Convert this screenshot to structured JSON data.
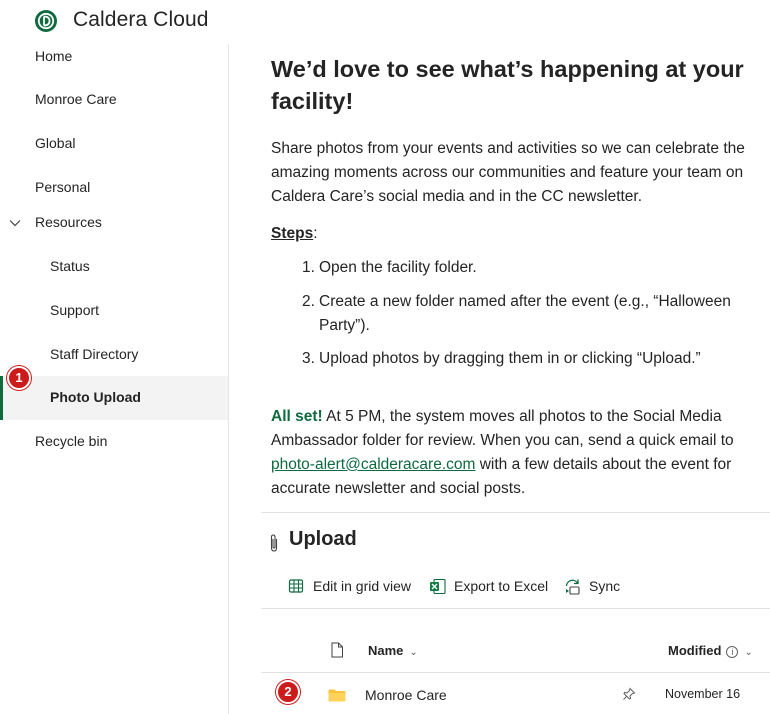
{
  "app": {
    "title": "Caldera Cloud"
  },
  "sidebar": {
    "items": [
      {
        "label": "Home"
      },
      {
        "label": "Monroe Care"
      },
      {
        "label": "Global"
      },
      {
        "label": "Personal"
      },
      {
        "label": "Resources"
      },
      {
        "label": "Status"
      },
      {
        "label": "Support"
      },
      {
        "label": "Staff Directory"
      },
      {
        "label": "Photo Upload"
      },
      {
        "label": "Recycle bin"
      }
    ],
    "selected": "Photo Upload"
  },
  "badges": {
    "one": "1",
    "two": "2"
  },
  "main": {
    "heading": "We’d love to see what’s happening at your facility!",
    "intro": "Share photos from your events and activities so we can celebrate the amazing moments across our communities and feature your team on Caldera Care’s social media and in the CC newsletter.",
    "steps_label": "Steps",
    "steps_colon": ":",
    "steps": [
      {
        "num": "1.",
        "text": "Open the facility folder."
      },
      {
        "num": "2.",
        "text": "Create a new folder named after the event (e.g., “Halloween",
        "text2": "Party”)."
      },
      {
        "num": "3.",
        "text": "Upload photos by dragging them in or clicking “Upload.”"
      }
    ],
    "allset_label": "All set!",
    "allset_text1": " At 5 PM, the system moves all photos to the Social Media Ambassador folder for review. When you can, send a quick email to ",
    "email": "photo-alert@calderacare.com",
    "allset_text2": " with a few details about the event for accurate newsletter and social posts."
  },
  "library": {
    "title": "Upload",
    "commands": {
      "grid": "Edit in grid view",
      "excel": "Export to Excel",
      "sync": "Sync"
    },
    "columns": {
      "name": "Name",
      "modified": "Modified"
    },
    "rows": [
      {
        "name": "Monroe Care",
        "modified": "November 16"
      }
    ]
  },
  "colors": {
    "accent": "#0f6b3f",
    "badge": "#cc1b1b"
  }
}
